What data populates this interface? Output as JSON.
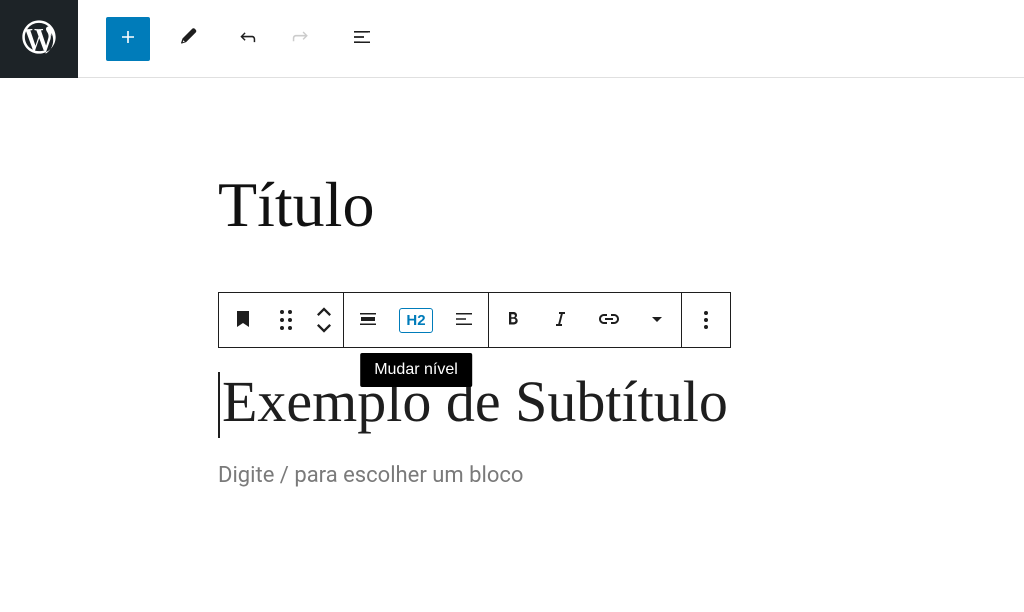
{
  "editor": {
    "post_title": "Título",
    "heading_text": "Exemplo de Subtítulo",
    "placeholder": "Digite / para escolher um bloco",
    "heading_level_label": "H2"
  },
  "tooltip": {
    "change_level": "Mudar nível"
  },
  "colors": {
    "primary": "#007cba",
    "text": "#1e1e1e",
    "wp_admin_bg": "#1d2327"
  }
}
